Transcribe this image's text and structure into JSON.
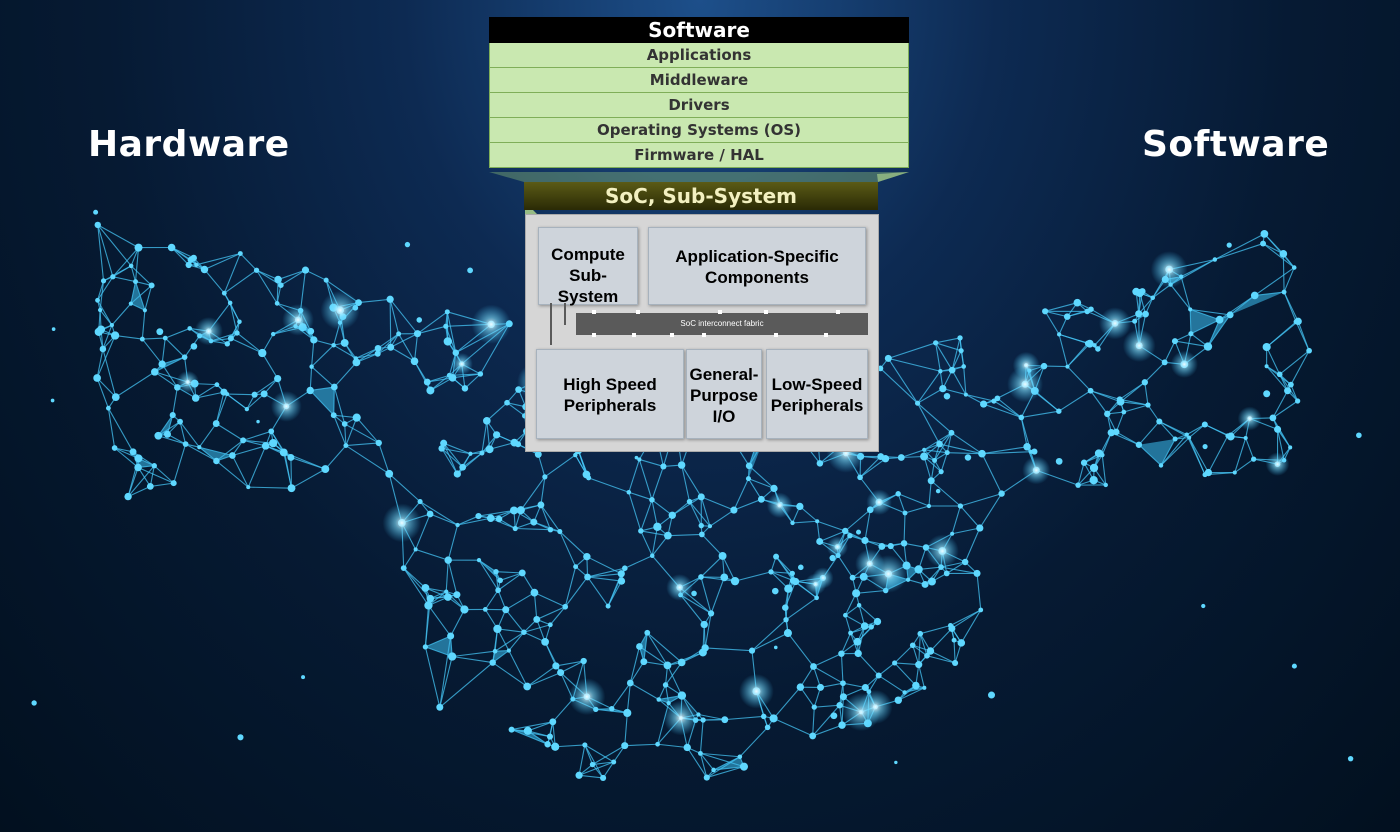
{
  "left_title": "Hardware",
  "right_title": "Software",
  "software_stack": {
    "header": "Software",
    "layers": [
      "Applications",
      "Middleware",
      "Drivers",
      "Operating Systems (OS)",
      "Firmware / HAL"
    ]
  },
  "soc": {
    "header": "SoC, Sub-System",
    "interconnect_label": "SoC interconnect  fabric",
    "blocks": {
      "compute": "Compute Sub-System",
      "app_specific": "Application-Specific Components",
      "high_speed": "High Speed Peripherals",
      "gpio": "General-Purpose I/O",
      "low_speed": "Low-Speed Peripherals"
    }
  },
  "colors": {
    "network": "#3fc8ff",
    "layer_fill": "#c9e8b0",
    "soc_header": "#4a4a10"
  }
}
